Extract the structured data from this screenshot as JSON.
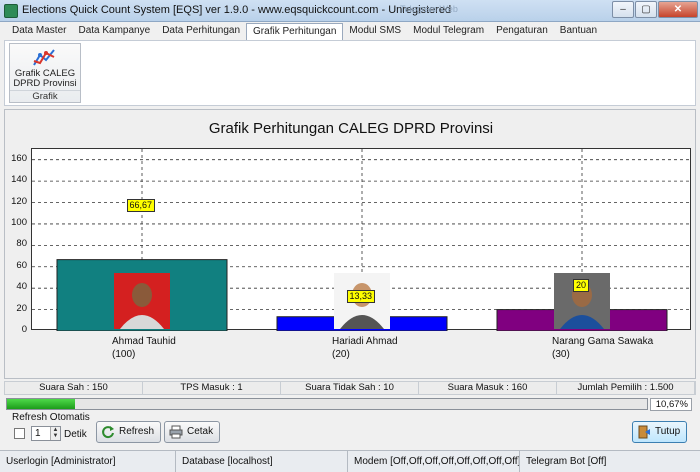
{
  "window": {
    "title": "Elections Quick Count System [EQS] ver 1.9.0 - www.eqsquickcount.com - Unregistered",
    "faded_text": "Telegram Web",
    "minimize": "–",
    "maximize": "▢",
    "close": "✕"
  },
  "tabs": [
    "Data Master",
    "Data Kampanye",
    "Data Perhitungan",
    "Grafik Perhitungan",
    "Modul SMS",
    "Modul Telegram",
    "Pengaturan",
    "Bantuan"
  ],
  "active_tab": "Grafik Perhitungan",
  "ribbon": {
    "button_line1": "Grafik CALEG",
    "button_line2": "DPRD Provinsi",
    "group_label": "Grafik"
  },
  "chart_data": {
    "type": "bar",
    "title": "Grafik Perhitungan CALEG DPRD Provinsi",
    "ylim": [
      0,
      170
    ],
    "yticks": [
      0,
      20,
      40,
      60,
      80,
      100,
      120,
      140,
      160
    ],
    "grid": true,
    "categories": [
      "Ahmad Tauhid",
      "Hariadi Ahmad",
      "Narang Gama Sawaka"
    ],
    "category_counts": [
      "(100)",
      "(20)",
      "(30)"
    ],
    "values": [
      66.67,
      13.33,
      20
    ],
    "value_labels": [
      "66,67",
      "13,33",
      "20"
    ],
    "colors": [
      "#118080",
      "#0000ff",
      "#800080"
    ]
  },
  "stats": {
    "suara_sah": "Suara Sah : 150",
    "tps_masuk": "TPS Masuk : 1",
    "suara_tidak_sah": "Suara Tidak Sah : 10",
    "suara_masuk": "Suara Masuk : 160",
    "jumlah_pemilih": "Jumlah Pemilih : 1.500"
  },
  "progress": {
    "fraction": 0.1067,
    "label": "10,67%"
  },
  "refresh": {
    "group_label": "Refresh Otomatis",
    "interval_value": "1",
    "unit_label": "Detik",
    "refresh_button": "Refresh",
    "print_button": "Cetak",
    "close_button": "Tutup"
  },
  "statusbar": {
    "user": "Userlogin [Administrator]",
    "database": "Database [localhost]",
    "modem": "Modem [Off,Off,Off,Off,Off,Off,Off,Off]",
    "telegram": "Telegram Bot [Off]"
  }
}
